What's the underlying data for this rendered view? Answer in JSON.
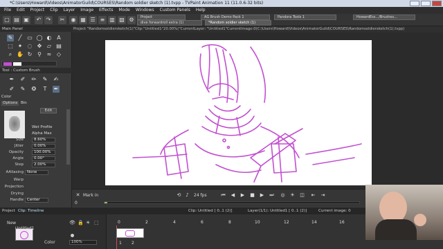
{
  "window": {
    "title": "*C:\\Users\\Howard\\Videos\\AnimatorGuild\\COURSES\\Random soldier sketch (1).tvpp - TVPaint Animation 11 (11.0.6-32 bits)"
  },
  "menu": [
    "File",
    "Edit",
    "Project",
    "Clip",
    "Layer",
    "Image",
    "Effects",
    "Mode",
    "Windows",
    "Custom Panels",
    "Help"
  ],
  "tabs": {
    "row1": [
      {
        "label": "Project"
      },
      {
        "label": "AG Brush Demo Pack 1"
      },
      {
        "label": "Pandora Tools 1"
      },
      {
        "label": "HowardEss.../Brushes..."
      }
    ],
    "row2": [
      {
        "label": "dive forwardroll extra (1)"
      },
      {
        "label": "*Random soldier sketch (1)"
      }
    ]
  },
  "leftpanel": {
    "main_panel_title": "Main Panel",
    "tool_title": "Tool : Custom Brush",
    "color_label": "Color",
    "options_tab": "Options",
    "bin_tab": "Bin",
    "edit_button": "Edit",
    "wet_profile": "Wet Profile",
    "alpha_max": "Alpha Max",
    "props": [
      {
        "label": "Size",
        "value": "8.60%"
      },
      {
        "label": "Jitter",
        "value": "0.00%"
      },
      {
        "label": "Opacity",
        "value": "100.00%"
      },
      {
        "label": "Angle",
        "value": "0.00°"
      },
      {
        "label": "Step",
        "value": "2.00%"
      }
    ],
    "aaliasing_label": "AAliasing",
    "aaliasing_value": "None",
    "warp_label": "Warp",
    "projection_label": "Projection",
    "drying_label": "Drying",
    "handle_label": "Handle",
    "handle_value": "Center"
  },
  "viewer": {
    "header": "Project \"Randomsoldiersketch(1)\"Clip:\"Untitled1\"20.00%(\"CurrentLayer: \"Untitled1\"CurrentImage:0(C:\\Users\\Howard\\Videos\\AnimatorGuild\\COURSES\\Randomsoldiersketch(1).tvpp)"
  },
  "playbar": {
    "markin": "Mark in",
    "fps": "24 fps",
    "zero": "0"
  },
  "status": {
    "project": "Project",
    "clip": "Clip: Timeline",
    "clip_info": "Clip: Untitled [ 0..1 (2)]",
    "layer_info": "Layer(1/1): Untitled1 [ 0..1 (2)]",
    "current_image": "Current image: 0"
  },
  "timeline": {
    "new_label": "New",
    "layer_name": "Untitled1",
    "color_label": "Color",
    "opacity": "100%",
    "ruler": [
      "0",
      "2",
      "4",
      "6",
      "8",
      "10",
      "12",
      "14",
      "16"
    ],
    "frame_nums": [
      "1",
      "2"
    ]
  },
  "colors": {
    "sketch": "#c24fd0",
    "accent": "#5b6f86"
  }
}
